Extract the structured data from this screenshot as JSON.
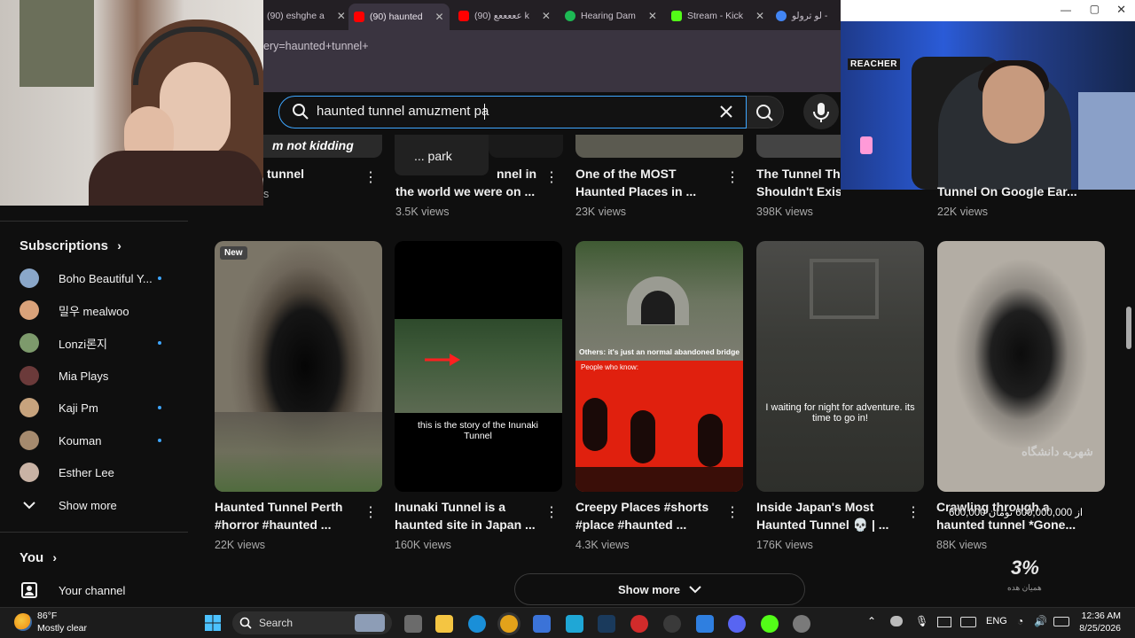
{
  "browser": {
    "tabs": [
      {
        "label": "(90) eshghe a",
        "color": "#d92b2b"
      },
      {
        "label": "(90) haunted",
        "color": "#ff0000"
      },
      {
        "label": "(90) عععععع k",
        "color": "#ff0000"
      },
      {
        "label": "Hearing Dam",
        "color": "#1db954"
      },
      {
        "label": "Stream - Kick",
        "color": "#53fc18"
      },
      {
        "label": "لو ترولو -",
        "color": "#4285f4"
      }
    ],
    "url": "ery=haunted+tunnel+"
  },
  "search": {
    "query": "haunted tunnel amuzment pa",
    "suggestion": "... park"
  },
  "webcam_overlay": {
    "sign_text": "REACHER"
  },
  "top_row": [
    {
      "title_line1": "tunnel",
      "title_line2": "",
      "views": "s",
      "overlay": "m not kidding"
    },
    {
      "title_line1": "nnel in",
      "title_line2": "the world we were on ...",
      "views": "3.5K views"
    },
    {
      "title_line1": "One of the MOST",
      "title_line2": "Haunted Places in ...",
      "views": "23K views"
    },
    {
      "title_line1": "The Tunnel Tha",
      "title_line2": "Shouldn't Exist...",
      "views": "398K views"
    },
    {
      "title_line1": "",
      "title_line2": "Tunnel On Google Ear...",
      "views": "22K views"
    }
  ],
  "sidebar": {
    "subscriptions_title": "Subscriptions",
    "channels": [
      {
        "name": "Boho Beautiful Y...",
        "dot": true,
        "color": "#8aa7c9"
      },
      {
        "name": "밀우 mealwoo",
        "dot": false,
        "color": "#d9a27a"
      },
      {
        "name": "Lonzi론지",
        "dot": true,
        "color": "#7d9a6c"
      },
      {
        "name": "Mia Plays",
        "dot": false,
        "color": "#6b3a3a"
      },
      {
        "name": "Kaji Pm",
        "dot": true,
        "color": "#c7a37d"
      },
      {
        "name": "Kouman",
        "dot": true,
        "color": "#a58a6e"
      },
      {
        "name": "Esther Lee",
        "dot": false,
        "color": "#c9b3a5"
      }
    ],
    "show_more": "Show more",
    "you_title": "You",
    "your_channel": "Your channel"
  },
  "videos": [
    {
      "badge": "New",
      "title_line1": "Haunted Tunnel Perth",
      "title_line2": "#horror #haunted ...",
      "views": "22K views",
      "overlay": ""
    },
    {
      "badge": "",
      "title_line1": "Inunaki Tunnel is a",
      "title_line2": "haunted site in Japan ...",
      "views": "160K views",
      "overlay": "this is the story of the Inunaki Tunnel"
    },
    {
      "badge": "",
      "title_line1": "Creepy Places #shorts",
      "title_line2": "#place #haunted ...",
      "views": "4.3K views",
      "overlay": "Others: it's just an normal abandoned bridge",
      "overlay2": "People who know:"
    },
    {
      "badge": "",
      "title_line1": "Inside Japan's Most",
      "title_line2": "Haunted Tunnel 💀 | ...",
      "views": "176K views",
      "overlay": "I waiting for night for adventure. its time to go in!"
    },
    {
      "badge": "",
      "title_line1": "Crawling through a",
      "title_line2": "haunted tunnel *Gone...",
      "views": "88K views",
      "overlay": "",
      "watermark": "شهریه دانشگاه"
    }
  ],
  "progress_widget": {
    "value": "3%",
    "label": "همیان هده",
    "amount": "600,000 از 600,000,000 تومان"
  },
  "show_more_button": "Show more",
  "taskbar": {
    "weather_temp": "86°F",
    "weather_desc": "Mostly clear",
    "search_label": "Search",
    "language": "ENG",
    "time": "12:36 AM",
    "date": "8/25/2026"
  }
}
